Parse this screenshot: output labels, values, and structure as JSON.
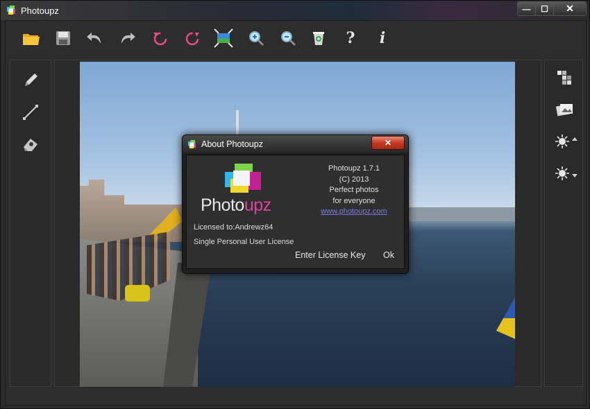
{
  "window": {
    "title": "Photoupz",
    "min_label": "—",
    "max_label": "☐",
    "close_label": "✕"
  },
  "toolbar": [
    {
      "name": "open-folder-icon"
    },
    {
      "name": "save-icon"
    },
    {
      "name": "undo-icon"
    },
    {
      "name": "redo-icon"
    },
    {
      "name": "rotate-left-icon"
    },
    {
      "name": "rotate-right-icon"
    },
    {
      "name": "fit-image-icon"
    },
    {
      "name": "zoom-in-icon"
    },
    {
      "name": "zoom-out-icon"
    },
    {
      "name": "recycle-bin-icon"
    },
    {
      "name": "help-icon",
      "glyph": "?"
    },
    {
      "name": "info-icon",
      "glyph": "i"
    }
  ],
  "left_tools": [
    "pencil-icon",
    "line-icon",
    "eraser-icon"
  ],
  "right_tools": [
    "mosaic-icon",
    "photos-icon",
    "brightness-up-icon",
    "brightness-down-icon"
  ],
  "about": {
    "title": "About Photoupz",
    "close_label": "✕",
    "logo_part1": "Photo",
    "logo_part2": "upz",
    "version": "Photoupz 1.7.1",
    "copyright": "(C) 2013",
    "tagline1": "Perfect photos",
    "tagline2": "for everyone",
    "website": "www.photoupz.com",
    "licensed_to": "Licensed to:Andrewz64",
    "license_type": "Single Personal User License",
    "enter_key_label": "Enter License Key",
    "ok_label": "Ok"
  },
  "colors": {
    "accent_pink": "#e040a0",
    "link": "#7a7ae8",
    "close_red": "#c63a24"
  }
}
